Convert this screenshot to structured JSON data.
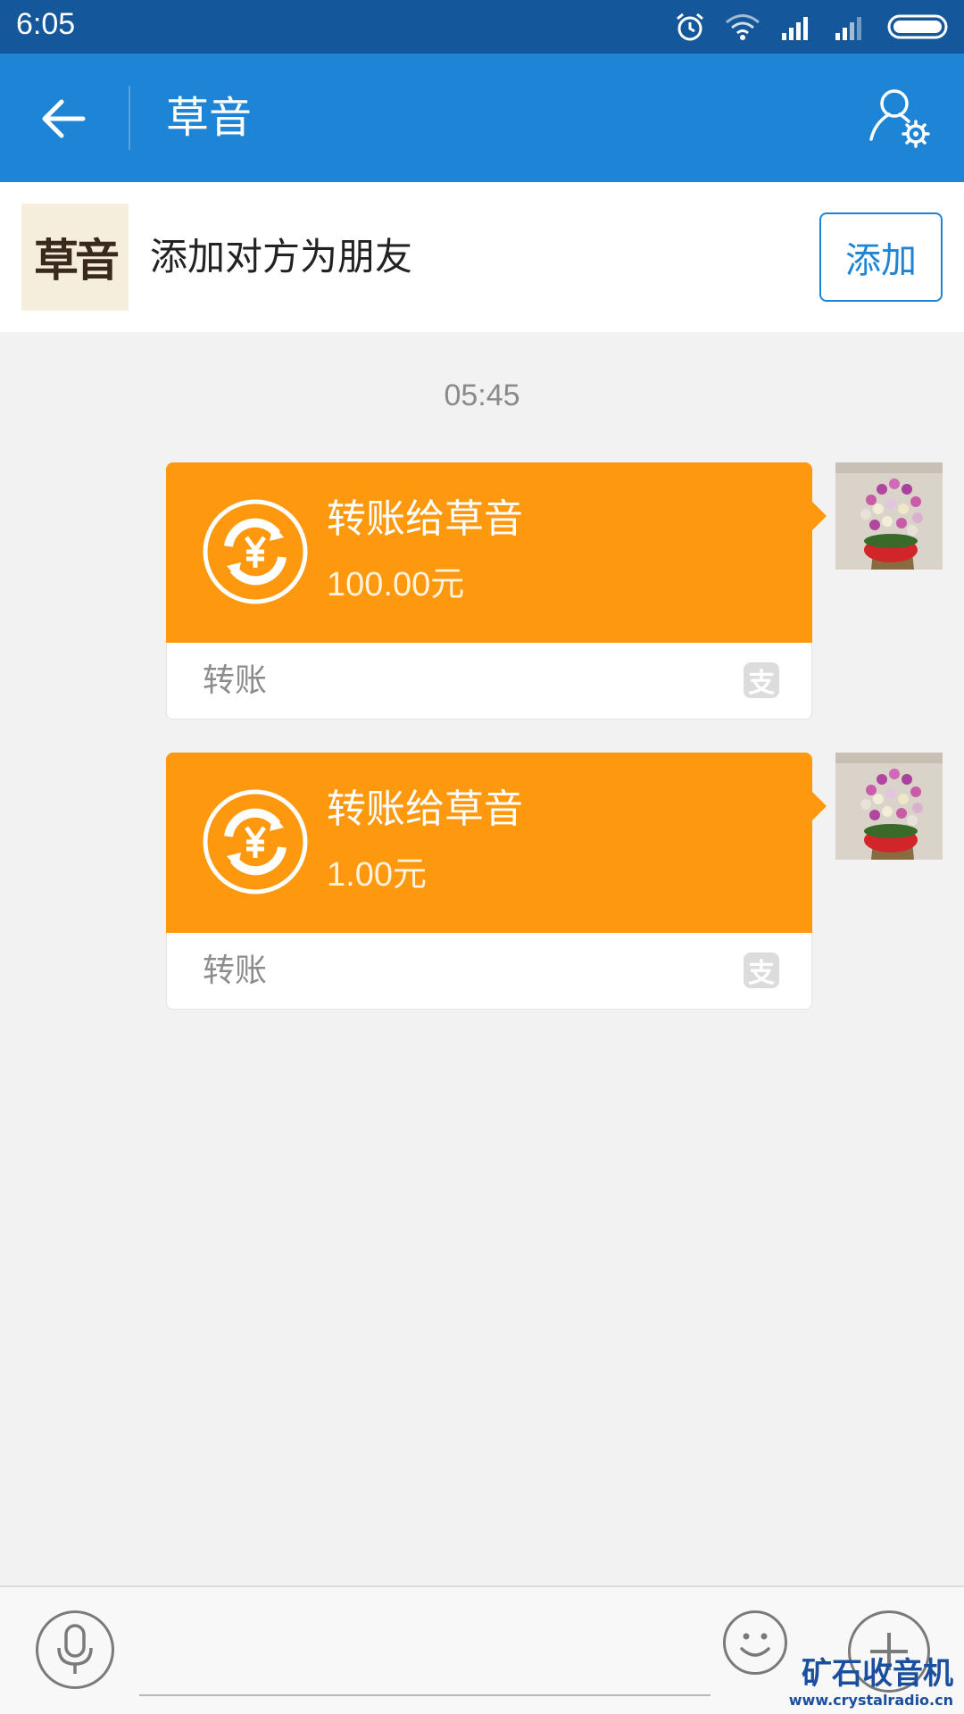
{
  "status_bar": {
    "time": "6:05",
    "icons": [
      "alarm-icon",
      "wifi-icon",
      "signal-icon",
      "signal-icon",
      "battery-icon"
    ]
  },
  "header": {
    "title": "草音",
    "back_icon": "back-arrow-icon",
    "settings_icon": "profile-settings-icon"
  },
  "add_friend": {
    "logo_text": "草音",
    "prompt": "添加对方为朋友",
    "button_label": "添加"
  },
  "chat": {
    "timestamp": "05:45",
    "messages": [
      {
        "title": "转账给草音",
        "amount": "100.00元",
        "label": "转账",
        "badge": "支"
      },
      {
        "title": "转账给草音",
        "amount": "1.00元",
        "label": "转账",
        "badge": "支"
      }
    ]
  },
  "input_bar": {
    "placeholder": "",
    "icons": [
      "microphone-icon",
      "emoji-icon",
      "plus-icon"
    ]
  },
  "watermark": {
    "title": "矿石收音机",
    "url": "www.crystalradio.cn"
  },
  "colors": {
    "status_bar": "#14579a",
    "header": "#1e84d6",
    "transfer_card": "#fe980e",
    "background": "#f2f2f2"
  }
}
